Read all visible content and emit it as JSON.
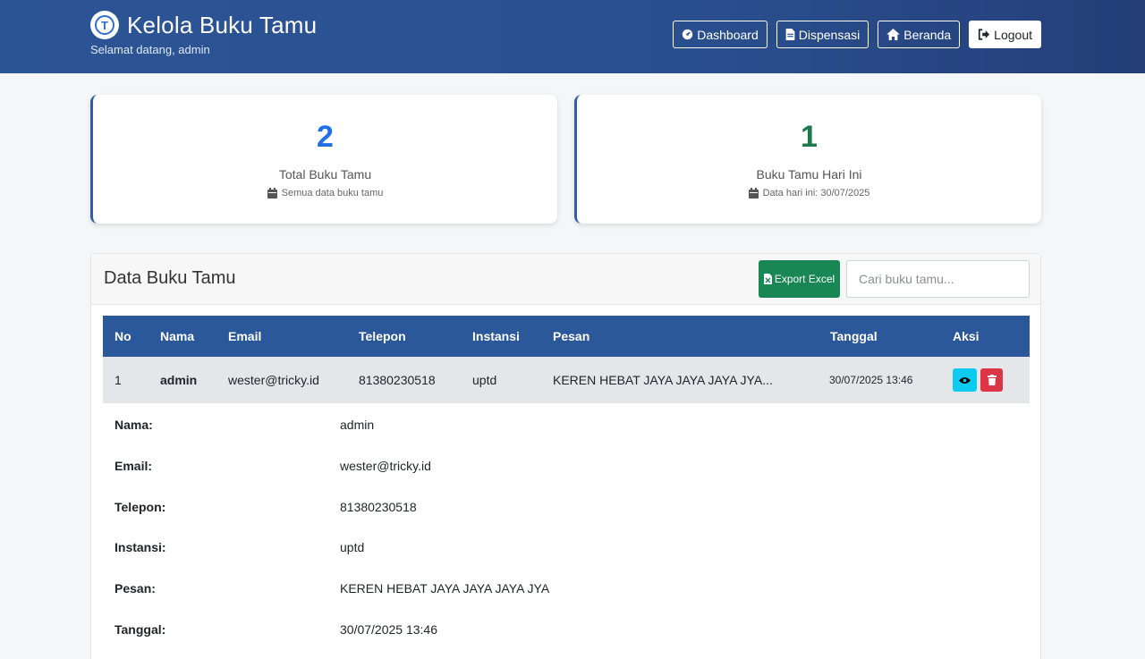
{
  "header": {
    "logo_text": "T",
    "title": "Kelola Buku Tamu",
    "subtitle": "Selamat datang, admin",
    "nav": {
      "dashboard": "Dashboard",
      "dispensasi": "Dispensasi",
      "beranda": "Beranda",
      "logout": "Logout"
    }
  },
  "stats": {
    "total": {
      "value": "2",
      "label": "Total Buku Tamu",
      "note": "Semua data buku tamu",
      "color": "#1f6fe5"
    },
    "today": {
      "value": "1",
      "label": "Buku Tamu Hari Ini",
      "note": "Data hari ini: 30/07/2025",
      "color": "#1e7a4a"
    }
  },
  "panel": {
    "title": "Data Buku Tamu",
    "export_label": "Export Excel",
    "search_placeholder": "Cari buku tamu..."
  },
  "table": {
    "columns": [
      "No",
      "Nama",
      "Email",
      "Telepon",
      "Instansi",
      "Pesan",
      "Tanggal",
      "Aksi"
    ],
    "rows": [
      {
        "no": "1",
        "nama": "admin",
        "email": "wester@tricky.id",
        "telepon": "81380230518",
        "instansi": "uptd",
        "pesan": "KEREN HEBAT JAYA JAYA JAYA JYA...",
        "tanggal": "30/07/2025 13:46"
      }
    ]
  },
  "detail": [
    {
      "label": "Nama:",
      "value": "admin"
    },
    {
      "label": "Email:",
      "value": "wester@tricky.id"
    },
    {
      "label": "Telepon:",
      "value": "81380230518"
    },
    {
      "label": "Instansi:",
      "value": "uptd"
    },
    {
      "label": "Pesan:",
      "value": "KEREN HEBAT JAYA JAYA JAYA JYA"
    },
    {
      "label": "Tanggal:",
      "value": "30/07/2025 13:46"
    }
  ],
  "icons": {
    "dashboard": "gauge-icon",
    "dispensasi": "file-icon",
    "beranda": "home-icon",
    "logout": "logout-icon",
    "calendar": "calendar-icon",
    "excel": "excel-file-icon",
    "view": "eye-icon",
    "delete": "trash-icon"
  }
}
